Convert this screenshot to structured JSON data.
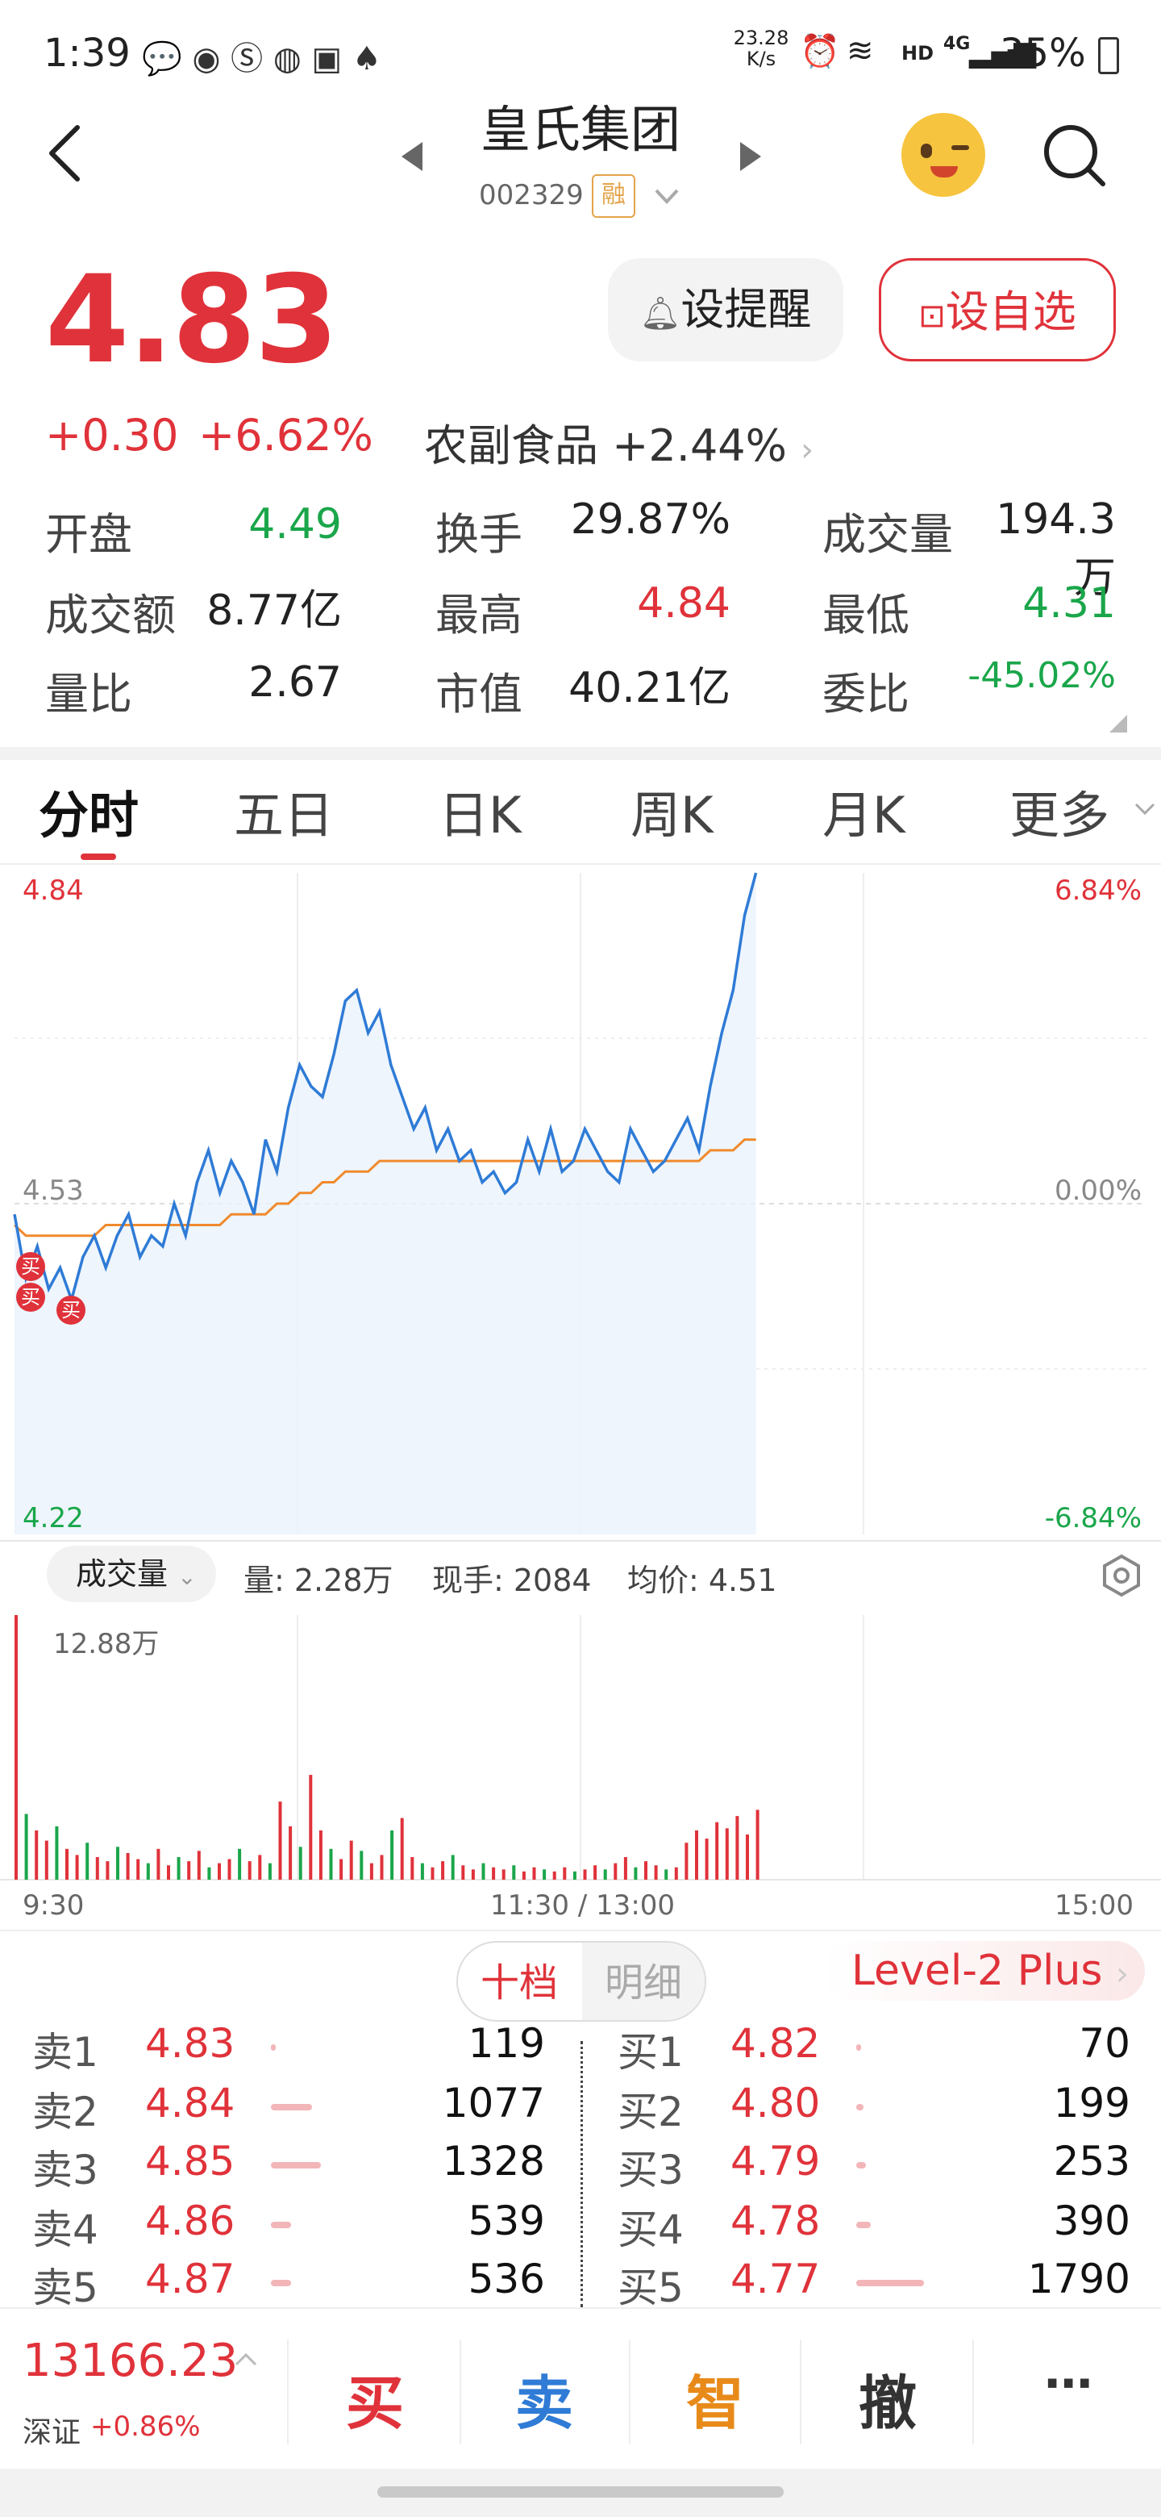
{
  "status_bar": {
    "time": "1:39",
    "net_speed_value": "23.28",
    "net_speed_unit": "K/s",
    "hd": "HD",
    "net_type": "4G",
    "battery": "35%"
  },
  "header": {
    "title": "皇氏集团",
    "code": "002329",
    "badge": "融"
  },
  "quote": {
    "price": "4.83",
    "change": "+0.30",
    "change_pct": "+6.62%",
    "sector": "农副食品",
    "sector_pct": "+2.44%"
  },
  "actions": {
    "alert": "设提醒",
    "watch": "设自选"
  },
  "stats": [
    {
      "label": "开盘",
      "value": "4.49",
      "color": "green"
    },
    {
      "label": "换手",
      "value": "29.87%",
      "color": "black"
    },
    {
      "label": "成交量",
      "value": "194.3万",
      "color": "black"
    },
    {
      "label": "成交额",
      "value": "8.77亿",
      "color": "black"
    },
    {
      "label": "最高",
      "value": "4.84",
      "color": "red"
    },
    {
      "label": "最低",
      "value": "4.31",
      "color": "green"
    },
    {
      "label": "量比",
      "value": "2.67",
      "color": "black"
    },
    {
      "label": "市值",
      "value": "40.21亿",
      "color": "black"
    },
    {
      "label": "委比",
      "value": "-45.02%",
      "color": "green"
    }
  ],
  "tabs": [
    "分时",
    "五日",
    "日K",
    "周K",
    "月K",
    "更多"
  ],
  "chart": {
    "price_top": "4.84",
    "price_mid": "4.53",
    "price_bottom": "4.22",
    "pct_top": "6.84%",
    "pct_mid": "0.00%",
    "pct_bottom": "-6.84%",
    "trade_marker": "买"
  },
  "chart_data": {
    "type": "line",
    "ylim": [
      4.22,
      4.84
    ],
    "x": [
      "9:30",
      "11:30 / 13:00",
      "15:00"
    ],
    "series": [
      {
        "values": [
          4.52,
          4.46,
          4.49,
          4.45,
          4.47,
          4.44,
          4.48,
          4.5,
          4.47,
          4.5,
          4.52,
          4.48,
          4.5,
          4.49,
          4.53,
          4.5,
          4.55,
          4.58,
          4.54,
          4.57,
          4.55,
          4.52,
          4.59,
          4.56,
          4.62,
          4.66,
          4.64,
          4.63,
          4.67,
          4.72,
          4.73,
          4.69,
          4.71,
          4.66,
          4.63,
          4.6,
          4.62,
          4.58,
          4.6,
          4.57,
          4.58,
          4.55,
          4.56,
          4.54,
          4.55,
          4.59,
          4.56,
          4.6,
          4.56,
          4.57,
          4.6,
          4.58,
          4.56,
          4.55,
          4.6,
          4.58,
          4.56,
          4.57,
          4.59,
          4.61,
          4.58,
          4.64,
          4.69,
          4.73,
          4.8,
          4.84
        ]
      },
      {
        "values": [
          4.51,
          4.5,
          4.5,
          4.5,
          4.5,
          4.5,
          4.5,
          4.5,
          4.51,
          4.51,
          4.51,
          4.51,
          4.51,
          4.51,
          4.51,
          4.51,
          4.51,
          4.51,
          4.51,
          4.52,
          4.52,
          4.52,
          4.52,
          4.53,
          4.53,
          4.54,
          4.54,
          4.55,
          4.55,
          4.56,
          4.56,
          4.56,
          4.57,
          4.57,
          4.57,
          4.57,
          4.57,
          4.57,
          4.57,
          4.57,
          4.57,
          4.57,
          4.57,
          4.57,
          4.57,
          4.57,
          4.57,
          4.57,
          4.57,
          4.57,
          4.57,
          4.57,
          4.57,
          4.57,
          4.57,
          4.57,
          4.57,
          4.57,
          4.57,
          4.57,
          4.57,
          4.58,
          4.58,
          4.58,
          4.59,
          4.59
        ]
      }
    ],
    "volume_max": "12.88万",
    "volume": [
      12.88,
      3.2,
      2.4,
      1.9,
      2.6,
      1.5,
      1.2,
      1.8,
      1.1,
      0.9,
      1.6,
      1.3,
      1.0,
      0.8,
      1.5,
      0.7,
      1.1,
      0.9,
      1.4,
      0.6,
      0.8,
      1.0,
      1.5,
      0.9,
      1.2,
      0.8,
      3.8,
      2.6,
      1.6,
      5.1,
      2.4,
      1.5,
      1.0,
      1.9,
      1.4,
      0.8,
      1.2,
      2.4,
      3.0,
      1.1,
      0.8,
      0.6,
      0.9,
      1.2,
      0.7,
      0.5,
      0.8,
      0.6,
      0.5,
      0.7,
      0.4,
      0.6,
      0.5,
      0.4,
      0.6,
      0.4,
      0.5,
      0.7,
      0.5,
      0.8,
      1.1,
      0.6,
      0.9,
      0.7,
      0.5,
      0.6,
      1.8,
      2.4,
      2.0,
      2.8,
      2.5,
      3.1,
      2.2,
      3.4
    ]
  },
  "volume_toolbar": {
    "selector": "成交量",
    "vol": "量: 2.28万",
    "now_hand": "现手: 2084",
    "avg": "均价: 4.51"
  },
  "time_axis": {
    "start": "9:30",
    "mid": "11:30 / 13:00",
    "end": "15:00"
  },
  "orderbook_tabs": {
    "left": "十档",
    "right": "明细",
    "level2": "Level-2 Plus"
  },
  "asks": [
    {
      "label": "卖1",
      "price": "4.83",
      "qty": "119"
    },
    {
      "label": "卖2",
      "price": "4.84",
      "qty": "1077"
    },
    {
      "label": "卖3",
      "price": "4.85",
      "qty": "1328"
    },
    {
      "label": "卖4",
      "price": "4.86",
      "qty": "539"
    },
    {
      "label": "卖5",
      "price": "4.87",
      "qty": "536"
    }
  ],
  "bids": [
    {
      "label": "买1",
      "price": "4.82",
      "qty": "70"
    },
    {
      "label": "买2",
      "price": "4.80",
      "qty": "199"
    },
    {
      "label": "买3",
      "price": "4.79",
      "qty": "253"
    },
    {
      "label": "买4",
      "price": "4.78",
      "qty": "390"
    },
    {
      "label": "买5",
      "price": "4.77",
      "qty": "1790"
    }
  ],
  "bottom": {
    "index_value": "13166.23",
    "index_name": "深证",
    "index_pct": "+0.86%",
    "buy": "买",
    "sell": "卖",
    "smart": "智",
    "cancel": "撤",
    "more": "⋯"
  },
  "colors": {
    "up": "#e0323a",
    "down": "#1aa64a",
    "line": "#2f7bd6",
    "avg": "#f08a2c"
  }
}
